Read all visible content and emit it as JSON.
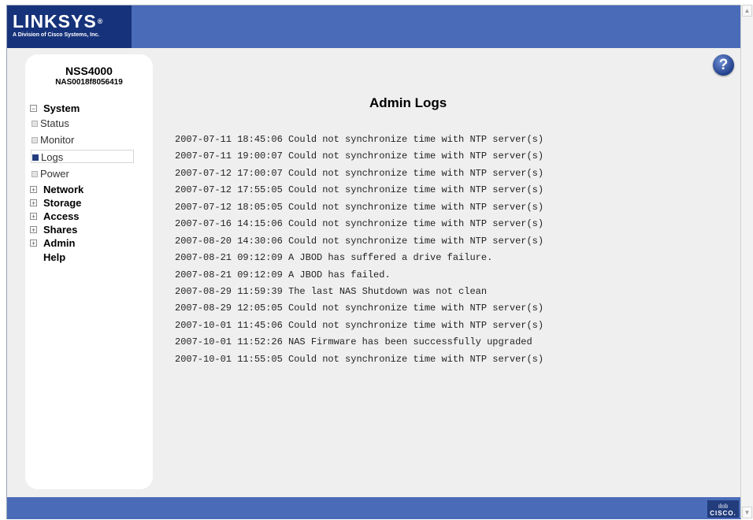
{
  "header": {
    "brand": "LINKSYS",
    "brand_mark": "®",
    "brand_sub": "A Division of Cisco Systems, Inc."
  },
  "help": {
    "label": "?"
  },
  "device": {
    "model": "NSS4000",
    "serial": "NAS0018f8056419"
  },
  "nav": {
    "system": "System",
    "system_expander": "−",
    "status": "Status",
    "monitor": "Monitor",
    "logs": "Logs",
    "power": "Power",
    "network": "Network",
    "storage": "Storage",
    "access": "Access",
    "shares": "Shares",
    "admin": "Admin",
    "help": "Help",
    "collapsed_expander": "+",
    "active_item": "Logs"
  },
  "main": {
    "title": "Admin Logs",
    "log_entries": [
      "2007-07-11 18:45:06 Could not synchronize time with NTP server(s)",
      "2007-07-11 19:00:07 Could not synchronize time with NTP server(s)",
      "2007-07-12 17:00:07 Could not synchronize time with NTP server(s)",
      "2007-07-12 17:55:05 Could not synchronize time with NTP server(s)",
      "2007-07-12 18:05:05 Could not synchronize time with NTP server(s)",
      "2007-07-16 14:15:06 Could not synchronize time with NTP server(s)",
      "2007-08-20 14:30:06 Could not synchronize time with NTP server(s)",
      "2007-08-21 09:12:09 A JBOD has suffered a drive failure.",
      "2007-08-21 09:12:09 A JBOD has failed.",
      "2007-08-29 11:59:39 The last NAS Shutdown was not clean",
      "2007-08-29 12:05:05 Could not synchronize time with NTP server(s)",
      "2007-10-01 11:45:06 Could not synchronize time with NTP server(s)",
      "2007-10-01 11:52:26 NAS Firmware has been successfully upgraded",
      "2007-10-01 11:55:05 Could not synchronize time with NTP server(s)"
    ]
  },
  "footer": {
    "cisco_bars": "ılıılı",
    "cisco_text": "CISCO."
  },
  "scrollbar": {
    "up_arrow": "▲",
    "down_arrow": "▼"
  },
  "colors": {
    "header_blue": "#4a6cb8",
    "logo_navy": "#16327a",
    "active_bullet": "#223c7c",
    "page_background": "#efefef"
  }
}
